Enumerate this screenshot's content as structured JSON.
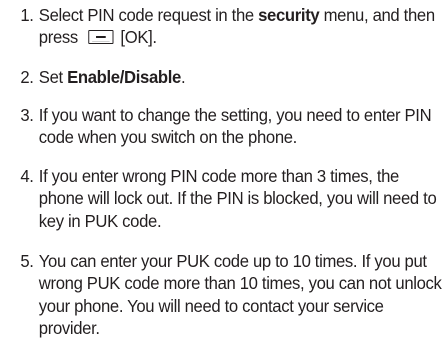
{
  "steps": [
    {
      "number": "1.",
      "pre": "Select PIN code request in the ",
      "bold": "security",
      "mid": " menu, and then press ",
      "key_icon": "left-soft-key-icon",
      "post": " [OK]."
    },
    {
      "number": "2.",
      "pre": "Set ",
      "bold": "Enable/Disable",
      "post": "."
    },
    {
      "number": "3.",
      "text": "If you want to change the setting, you need to enter PIN code when you switch on the phone."
    },
    {
      "number": "4.",
      "text": "If you enter wrong PIN code more than 3 times, the phone will lock out. If the PIN is blocked, you will need to key in PUK code."
    },
    {
      "number": "5.",
      "text": "You can enter your PUK code up to 10 times. If you put wrong PUK code more than 10 times, you can not unlock your phone. You will need to contact your service provider."
    }
  ]
}
